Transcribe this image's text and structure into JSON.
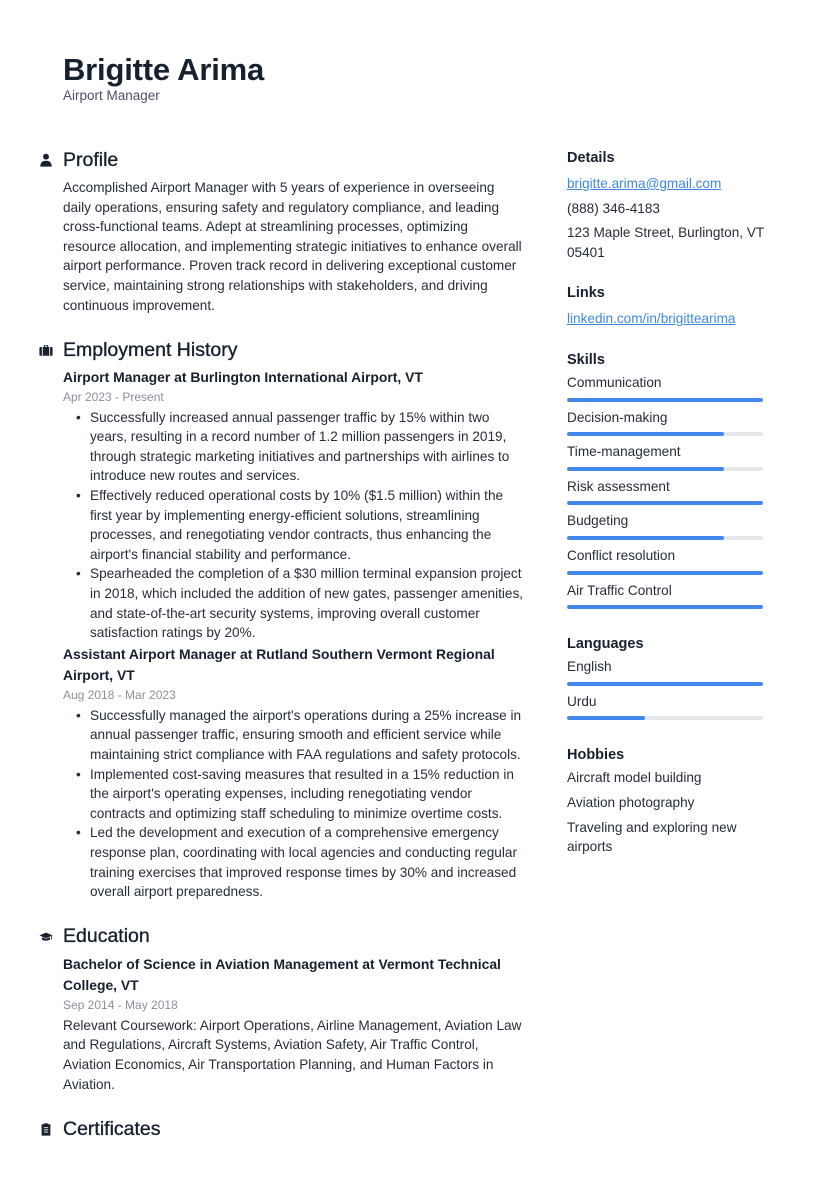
{
  "header": {
    "name": "Brigitte Arima",
    "title": "Airport Manager"
  },
  "profile": {
    "heading": "Profile",
    "icon": "user-icon",
    "text": "Accomplished Airport Manager with 5 years of experience in overseeing daily operations, ensuring safety and regulatory compliance, and leading cross-functional teams. Adept at streamlining processes, optimizing resource allocation, and implementing strategic initiatives to enhance overall airport performance. Proven track record in delivering exceptional customer service, maintaining strong relationships with stakeholders, and driving continuous improvement."
  },
  "employment": {
    "heading": "Employment History",
    "icon": "briefcase-icon",
    "jobs": [
      {
        "title": "Airport Manager at Burlington International Airport, VT",
        "dates": "Apr 2023 - Present",
        "bullets": [
          "Successfully increased annual passenger traffic by 15% within two years, resulting in a record number of 1.2 million passengers in 2019, through strategic marketing initiatives and partnerships with airlines to introduce new routes and services.",
          "Effectively reduced operational costs by 10% ($1.5 million) within the first year by implementing energy-efficient solutions, streamlining processes, and renegotiating vendor contracts, thus enhancing the airport's financial stability and performance.",
          "Spearheaded the completion of a $30 million terminal expansion project in 2018, which included the addition of new gates, passenger amenities, and state-of-the-art security systems, improving overall customer satisfaction ratings by 20%."
        ]
      },
      {
        "title": "Assistant Airport Manager at Rutland Southern Vermont Regional Airport, VT",
        "dates": "Aug 2018 - Mar 2023",
        "bullets": [
          "Successfully managed the airport's operations during a 25% increase in annual passenger traffic, ensuring smooth and efficient service while maintaining strict compliance with FAA regulations and safety protocols.",
          "Implemented cost-saving measures that resulted in a 15% reduction in the airport's operating expenses, including renegotiating vendor contracts and optimizing staff scheduling to minimize overtime costs.",
          "Led the development and execution of a comprehensive emergency response plan, coordinating with local agencies and conducting regular training exercises that improved response times by 30% and increased overall airport preparedness."
        ]
      }
    ]
  },
  "education": {
    "heading": "Education",
    "icon": "graduation-cap-icon",
    "entries": [
      {
        "title": "Bachelor of Science in Aviation Management at Vermont Technical College, VT",
        "dates": "Sep 2014 - May 2018",
        "description": "Relevant Coursework: Airport Operations, Airline Management, Aviation Law and Regulations, Aircraft Systems, Aviation Safety, Air Traffic Control, Aviation Economics, Air Transportation Planning, and Human Factors in Aviation."
      }
    ]
  },
  "certificates": {
    "heading": "Certificates",
    "icon": "clipboard-icon"
  },
  "details": {
    "heading": "Details",
    "email": "brigitte.arima@gmail.com",
    "phone": "(888) 346-4183",
    "address": "123 Maple Street, Burlington, VT 05401"
  },
  "links": {
    "heading": "Links",
    "items": [
      "linkedin.com/in/brigittearima"
    ]
  },
  "skills": {
    "heading": "Skills",
    "items": [
      {
        "name": "Communication",
        "level": 1.0
      },
      {
        "name": "Decision-making",
        "level": 0.8
      },
      {
        "name": "Time-management",
        "level": 0.8
      },
      {
        "name": "Risk assessment",
        "level": 1.0
      },
      {
        "name": "Budgeting",
        "level": 0.8
      },
      {
        "name": "Conflict resolution",
        "level": 1.0
      },
      {
        "name": "Air Traffic Control",
        "level": 1.0
      }
    ]
  },
  "languages": {
    "heading": "Languages",
    "items": [
      {
        "name": "English",
        "level": 1.0
      },
      {
        "name": "Urdu",
        "level": 0.4
      }
    ]
  },
  "hobbies": {
    "heading": "Hobbies",
    "items": [
      "Aircraft model building",
      "Aviation photography",
      "Traveling and exploring new airports"
    ]
  },
  "colors": {
    "accent": "#4287ea",
    "link": "#3f88e0",
    "heading": "#16202f",
    "muted": "#8a909a",
    "track": "#e6e7ea"
  }
}
